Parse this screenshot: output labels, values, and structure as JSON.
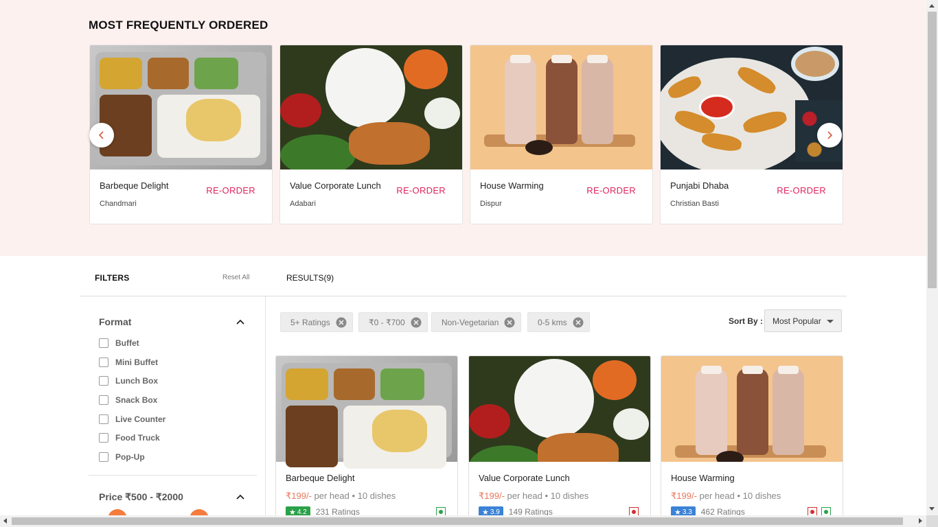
{
  "most_frequent": {
    "title": "MOST FREQUENTLY ORDERED",
    "reorder_label": "RE-ORDER",
    "cards": [
      {
        "name": "Barbeque Delight",
        "location": "Chandmari"
      },
      {
        "name": "Value Corporate Lunch",
        "location": "Adabari"
      },
      {
        "name": "House Warming",
        "location": "Dispur"
      },
      {
        "name": "Punjabi Dhaba",
        "location": "Christian Basti"
      }
    ],
    "prev_icon": "chevron-left-icon",
    "next_icon": "chevron-right-icon"
  },
  "filters": {
    "label": "FILTERS",
    "reset_label": "Reset All",
    "format": {
      "title": "Format",
      "options": [
        "Buffet",
        "Mini Buffet",
        "Lunch Box",
        "Snack Box",
        "Live Counter",
        "Food Truck",
        "Pop-Up"
      ]
    },
    "price": {
      "title": "Price ₹500 - ₹2000"
    }
  },
  "results": {
    "label": "RESULTS(9)",
    "chips": [
      "5+ Ratings",
      "₹0 - ₹700",
      "Non-Vegetarian",
      "0-5 kms"
    ],
    "sort_label": "Sort By :",
    "sort_value": "Most Popular",
    "cards": [
      {
        "name": "Barbeque Delight",
        "price": "₹199/-",
        "per_head": "per head",
        "dishes": "10 dishes",
        "rating": "4.2",
        "ratings_count": "231 Ratings",
        "rating_color": "#2aa149",
        "diet": [
          "veg"
        ]
      },
      {
        "name": "Value Corporate Lunch",
        "price": "₹199/-",
        "per_head": "per head",
        "dishes": "10 dishes",
        "rating": "3.9",
        "ratings_count": "149 Ratings",
        "rating_color": "#3b82d6",
        "diet": [
          "non-veg"
        ]
      },
      {
        "name": "House Warming",
        "price": "₹199/-",
        "per_head": "per head",
        "dishes": "10 dishes",
        "rating": "3.3",
        "ratings_count": "462 Ratings",
        "rating_color": "#3b82d6",
        "diet": [
          "non-veg",
          "veg"
        ]
      }
    ]
  },
  "colors": {
    "accent": "#e0245e",
    "band_bg": "#fdf1ef",
    "price": "#e8765a",
    "slider_knob": "#f47c3c",
    "veg": "#2aa149",
    "non_veg": "#d32f2f"
  }
}
